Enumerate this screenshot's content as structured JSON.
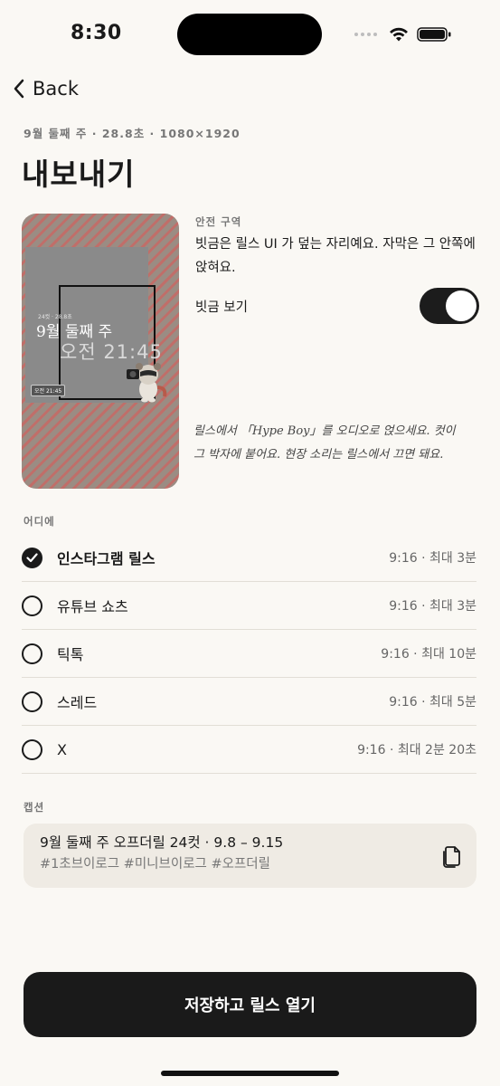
{
  "status": {
    "time": "8:30"
  },
  "nav": {
    "back_label": "Back"
  },
  "header": {
    "meta": "9월 둘째 주 · 28.8초 · 1080×1920",
    "title": "내보내기"
  },
  "preview": {
    "small_text": "24컷 · 28.8초",
    "week_text": "9월 둘째 주",
    "time_text": "오전 21:45",
    "chip_text": "오전 21:45"
  },
  "safe_zone": {
    "label": "안전 구역",
    "description": "빗금은 릴스 UI 가 덮는 자리예요. 자막은 그 안쪽에 앉혀요.",
    "toggle_label": "빗금 보기",
    "toggle_on": true
  },
  "note": "릴스에서 「Hype Boy」를 오디오로 얹으세요. 컷이 그 박자에 붙어요. 현장 소리는 릴스에서 끄면 돼요.",
  "destinations": {
    "label": "어디에",
    "items": [
      {
        "name": "인스타그램 릴스",
        "meta": "9:16 · 최대 3분",
        "checked": true
      },
      {
        "name": "유튜브 쇼츠",
        "meta": "9:16 · 최대 3분",
        "checked": false
      },
      {
        "name": "틱톡",
        "meta": "9:16 · 최대 10분",
        "checked": false
      },
      {
        "name": "스레드",
        "meta": "9:16 · 최대 5분",
        "checked": false
      },
      {
        "name": "X",
        "meta": "9:16 · 최대 2분 20초",
        "checked": false
      }
    ]
  },
  "caption": {
    "label": "캡션",
    "line1": "9월 둘째 주 오프더릴 24컷 · 9.8 – 9.15",
    "line2": "#1초브이로그 #미니브이로그 #오프더릴"
  },
  "cta": {
    "label": "저장하고 릴스 열기"
  },
  "colors": {
    "background": "#faf8f4",
    "primary": "#1a1a1a",
    "hatch": "#c06e69",
    "caption_bg": "#efebe4"
  }
}
